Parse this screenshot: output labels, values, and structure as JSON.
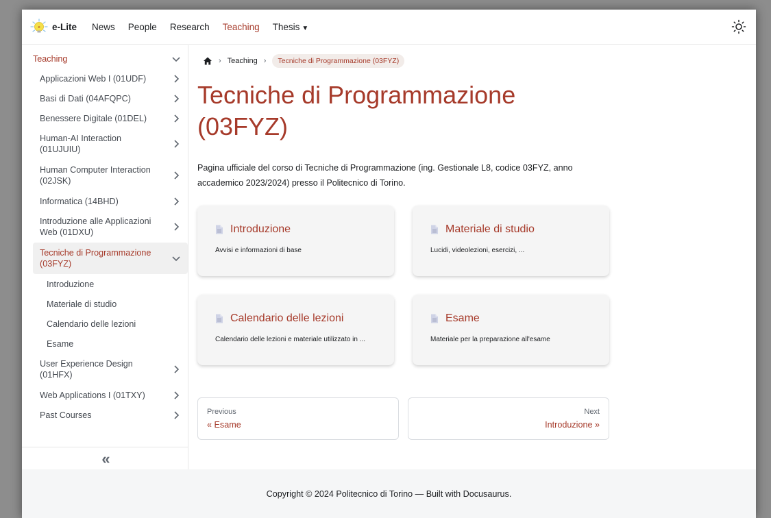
{
  "navbar": {
    "brand": "e-Lite",
    "items": [
      {
        "label": "News"
      },
      {
        "label": "People"
      },
      {
        "label": "Research"
      },
      {
        "label": "Teaching"
      },
      {
        "label": "Thesis"
      }
    ],
    "accent": "#a63a2a",
    "theme_icon": "sun-icon"
  },
  "sidebar": {
    "section": "Teaching",
    "items": [
      {
        "label": "Applicazioni Web I (01UDF)"
      },
      {
        "label": "Basi di Dati (04AFQPC)"
      },
      {
        "label": "Benessere Digitale (01DEL)"
      },
      {
        "label": "Human-AI Interaction (01UJUIU)"
      },
      {
        "label": "Human Computer Interaction (02JSK)"
      },
      {
        "label": "Informatica (14BHD)"
      },
      {
        "label": "Introduzione alle Applicazioni Web (01DXU)"
      },
      {
        "label": "Tecniche di Programmazione (03FYZ)"
      },
      {
        "label": "User Experience Design (01HFX)"
      },
      {
        "label": "Web Applications I (01TXY)"
      },
      {
        "label": "Past Courses"
      }
    ],
    "children": [
      {
        "label": "Introduzione"
      },
      {
        "label": "Materiale di studio"
      },
      {
        "label": "Calendario delle lezioni"
      },
      {
        "label": "Esame"
      }
    ],
    "collapse_label": "«"
  },
  "breadcrumb": {
    "items": [
      "Teaching",
      "Tecniche di Programmazione (03FYZ)"
    ],
    "separator": "›"
  },
  "main": {
    "title": "Tecniche di Programmazione (03FYZ)",
    "description": "Pagina ufficiale del corso di Tecniche di Programmazione (ing. Gestionale L8, codice 03FYZ, anno accademico 2023/2024) presso il Politecnico di Torino.",
    "cards": [
      {
        "title": "Introduzione",
        "desc": "Avvisi e informazioni di base"
      },
      {
        "title": "Materiale di studio",
        "desc": "Lucidi, videolezioni, esercizi, ..."
      },
      {
        "title": "Calendario delle lezioni",
        "desc": "Calendario delle lezioni e materiale utilizzato in ..."
      },
      {
        "title": "Esame",
        "desc": "Materiale per la preparazione all'esame"
      }
    ],
    "pager": {
      "prev_sub": "Previous",
      "prev_label": "« Esame",
      "next_sub": "Next",
      "next_label": "Introduzione »"
    }
  },
  "footer": {
    "text": "Copyright © 2024 Politecnico di Torino — Built with Docusaurus."
  }
}
